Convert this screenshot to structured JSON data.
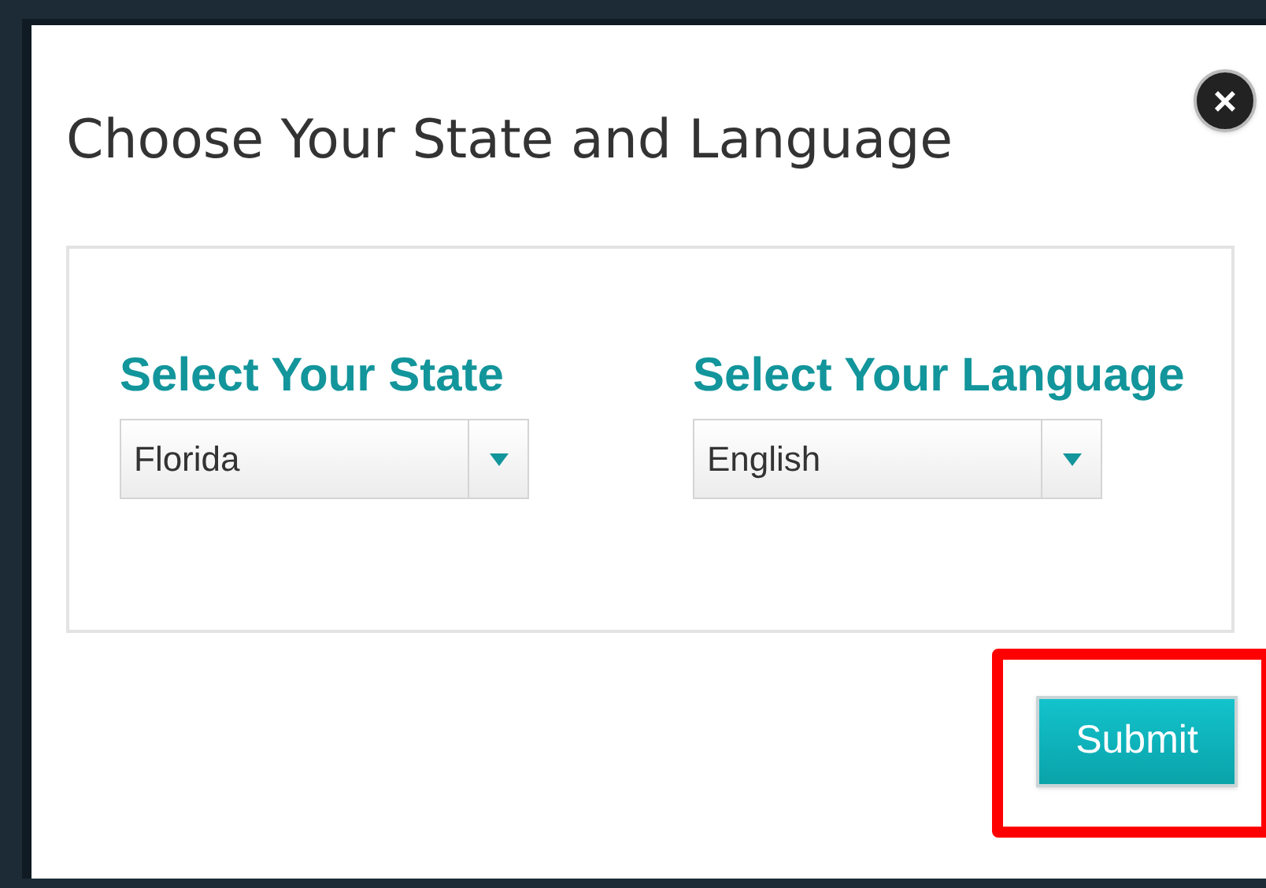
{
  "dialog": {
    "title": "Choose Your State and Language",
    "close_label": "×"
  },
  "fields": [
    {
      "label": "Select Your State",
      "value": "Florida"
    },
    {
      "label": "Select Your Language",
      "value": "English"
    }
  ],
  "submit": {
    "label": "Submit",
    "highlighted": true
  }
}
